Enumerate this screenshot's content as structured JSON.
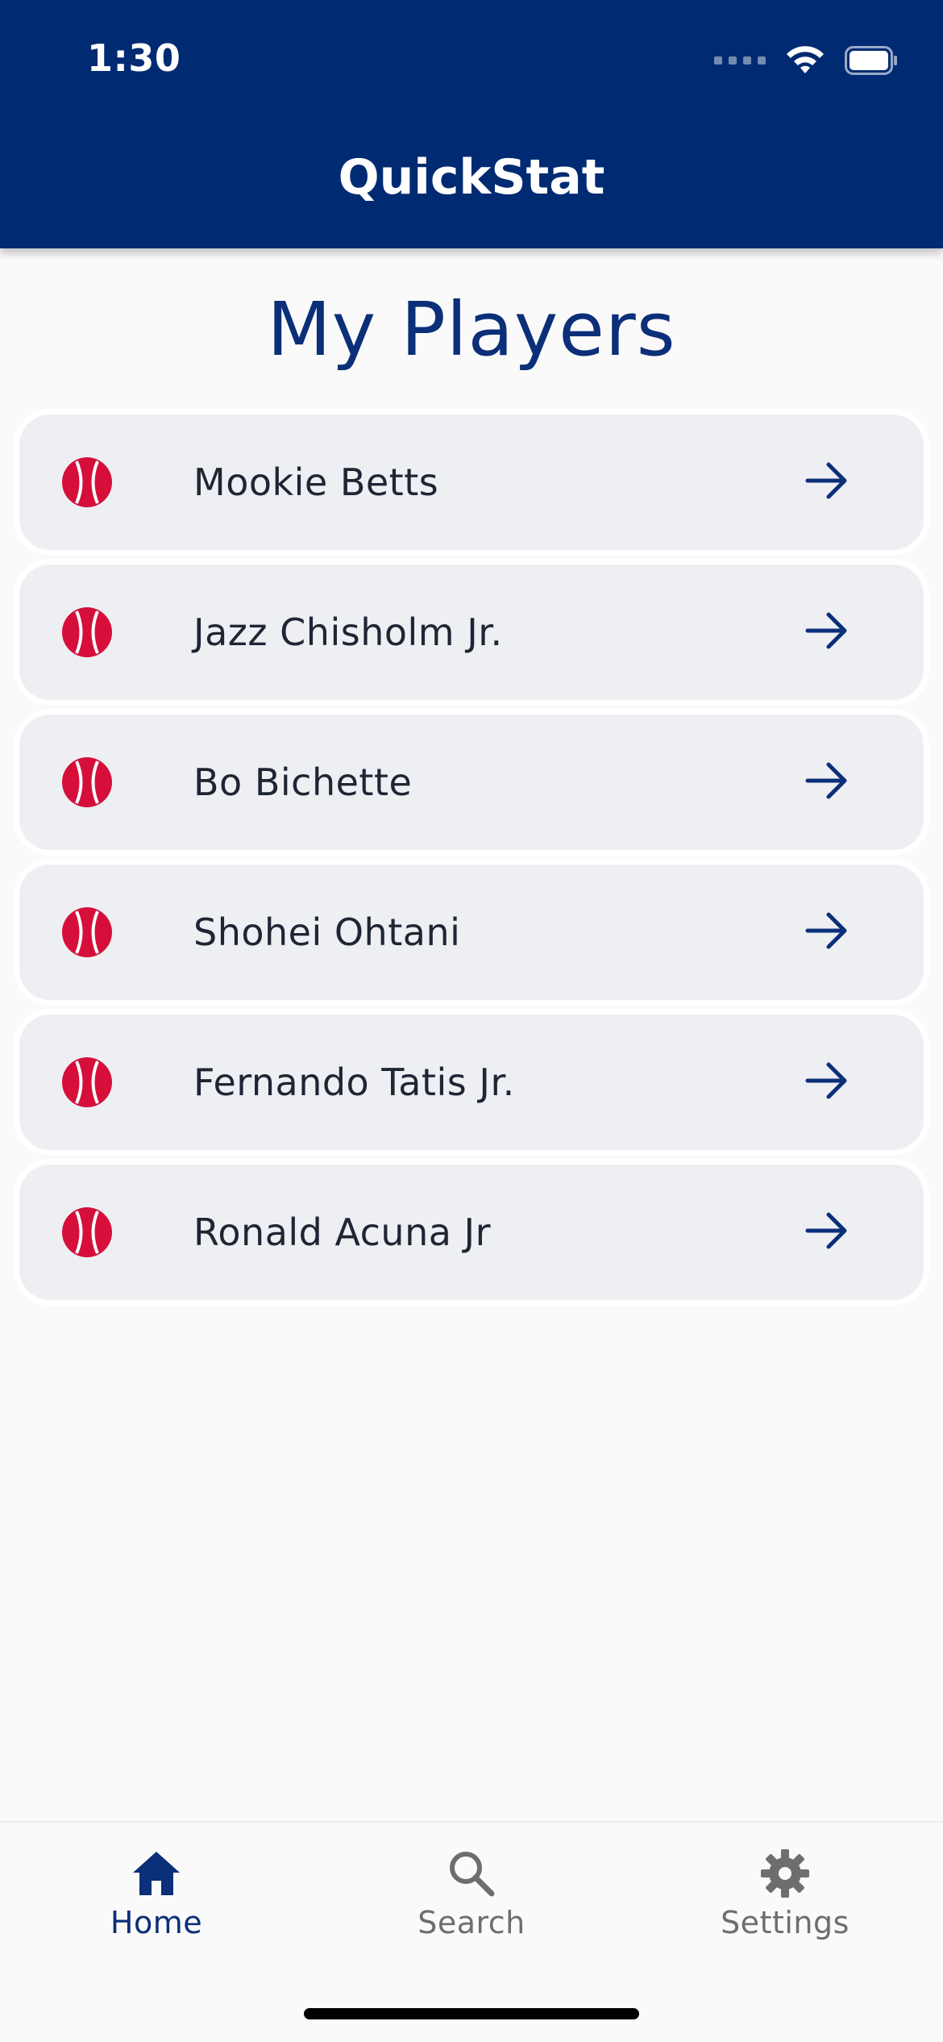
{
  "status_bar": {
    "time": "1:30"
  },
  "header": {
    "title": "QuickStat",
    "background_color": "#002a72"
  },
  "main": {
    "title": "My Players",
    "players": [
      {
        "name": "Mookie Betts",
        "icon": "baseball-icon",
        "action_icon": "arrow-right-icon"
      },
      {
        "name": "Jazz Chisholm Jr.",
        "icon": "baseball-icon",
        "action_icon": "arrow-right-icon"
      },
      {
        "name": "Bo Bichette",
        "icon": "baseball-icon",
        "action_icon": "arrow-right-icon"
      },
      {
        "name": "Shohei Ohtani",
        "icon": "baseball-icon",
        "action_icon": "arrow-right-icon"
      },
      {
        "name": "Fernando Tatis Jr.",
        "icon": "baseball-icon",
        "action_icon": "arrow-right-icon"
      },
      {
        "name": "Ronald Acuna Jr",
        "icon": "baseball-icon",
        "action_icon": "arrow-right-icon"
      }
    ]
  },
  "bottom_nav": {
    "items": [
      {
        "label": "Home",
        "icon": "home-icon",
        "active": true
      },
      {
        "label": "Search",
        "icon": "search-icon",
        "active": false
      },
      {
        "label": "Settings",
        "icon": "gear-icon",
        "active": false
      }
    ]
  },
  "colors": {
    "primary": "#002a72",
    "accent_red": "#d50f3a",
    "active_tab": "#0b2f78",
    "inactive_tab": "#6e6e6e",
    "row_background": "#eeeff3"
  }
}
